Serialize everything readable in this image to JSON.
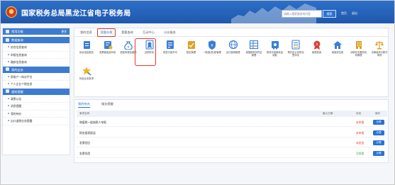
{
  "header": {
    "title": "国家税务总局黑龙江省电子税务局",
    "search_placeholder": "请输入搜索服务的内容",
    "search_button": "搜索",
    "links": [
      "首页",
      "退出"
    ]
  },
  "sidebar": {
    "sections": [
      {
        "title": "常用功能",
        "extra": "更多",
        "items": []
      },
      {
        "title": "数据查询",
        "extra": "",
        "items": [
          "综合信息查询",
          "申报信息查询",
          "缴款信息查询"
        ]
      },
      {
        "title": "我的业务",
        "extra": "",
        "items": [
          "税收户一体化平台",
          "个人企业个税信息"
        ]
      },
      {
        "title": "通知提醒",
        "extra": "",
        "items": [
          "政策公告",
          "消息提醒",
          "我的待办",
          "出口退税业务提醒"
        ]
      }
    ]
  },
  "main": {
    "tabs": [
      "我的信息",
      "我要办税",
      "我要查询",
      "互动中心",
      "公众服务"
    ],
    "active_tab": "我要办税",
    "services": [
      {
        "label": "综合信息报告",
        "icon": "report-icon",
        "color": "#3a7fd6"
      },
      {
        "label": "发票使用及申领",
        "icon": "invoice-icon",
        "color": "#3a7fd6"
      },
      {
        "label": "税费申报及缴纳",
        "icon": "tax-bag-icon",
        "color": "#3a7fd6"
      },
      {
        "label": "证明开具",
        "icon": "certificate-icon",
        "color": "#3a7fd6"
      },
      {
        "label": "税务行政许可",
        "icon": "permit-icon",
        "color": "#3a7fd6"
      },
      {
        "label": "核定管理",
        "icon": "check-doc-icon",
        "color": "#e0a020"
      },
      {
        "label": "一般退(抵)税管理",
        "icon": "refund-icon",
        "color": "#3a7fd6"
      },
      {
        "label": "出口退税管理",
        "icon": "globe-icon",
        "color": "#3a7fd6"
      },
      {
        "label": "增值税抵扣凭证管理",
        "icon": "grid-doc-icon",
        "color": "#3a7fd6"
      },
      {
        "label": "税务代保管资金收取",
        "icon": "safe-icon",
        "color": "#3a7fd6"
      },
      {
        "label": "预约定价安排谈签申请",
        "icon": "agreement-icon",
        "color": "#3a7fd6"
      },
      {
        "label": "纳税信用",
        "icon": "credit-icon",
        "color": "#d9433a"
      },
      {
        "label": "增量房交易",
        "icon": "house-icon",
        "color": "#3a7fd6"
      },
      {
        "label": "涉税专业服务机构管理",
        "icon": "building-icon",
        "color": "#e0a020"
      },
      {
        "label": "法律追责与救济事项",
        "icon": "scale-icon",
        "color": "#e0a020"
      },
      {
        "label": "特色业务事项",
        "icon": "star-pen-icon",
        "color": "#3a7fd6"
      }
    ],
    "highlighted": "证明开具"
  },
  "panel": {
    "tabs": [
      "我的待办",
      "服务提醒"
    ],
    "active_tab": "我的待办",
    "columns": [
      "事项名称",
      "截止日期",
      "状态",
      "操作"
    ],
    "rows": [
      {
        "name": "增值税一般纳税人申报",
        "status": "未申报",
        "action": "办理"
      },
      {
        "name": "财务报表报送",
        "status": "未申报",
        "action": "办理"
      },
      {
        "name": "发票验旧",
        "status": "未验旧",
        "action": "办理"
      },
      {
        "name": "发票领用",
        "status": "可领用",
        "action": "办理"
      }
    ]
  }
}
